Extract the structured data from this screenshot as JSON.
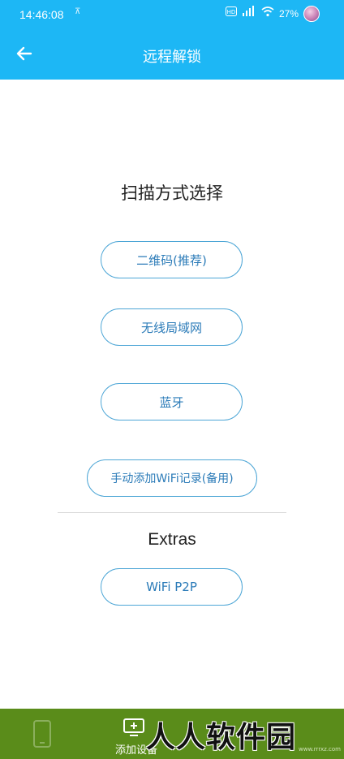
{
  "status_bar": {
    "time": "14:46:08",
    "sub_icon": "⊼",
    "battery": "27%",
    "icons": [
      "hd-icon",
      "signal-icon",
      "wifi-icon"
    ]
  },
  "app_bar": {
    "title": "远程解锁",
    "back_icon": "arrow-left-icon"
  },
  "main": {
    "heading": "扫描方式选择",
    "buttons": {
      "qr": "二维码(推荐)",
      "lan": "无线局域网",
      "bt": "蓝牙",
      "wifi_manual": "手动添加WiFi记录(备用)"
    },
    "extras_heading": "Extras",
    "extras_buttons": {
      "p2p": "WiFi P2P"
    }
  },
  "bottom_bar": {
    "add_device_label": "添加设备",
    "watermark": "人人软件园",
    "watermark_sub": "www.rrrxz.com",
    "color": "#5a8c1a"
  },
  "colors": {
    "accent": "#1db7f5",
    "button_border": "#4da6d6",
    "button_text": "#2b7bb8"
  }
}
